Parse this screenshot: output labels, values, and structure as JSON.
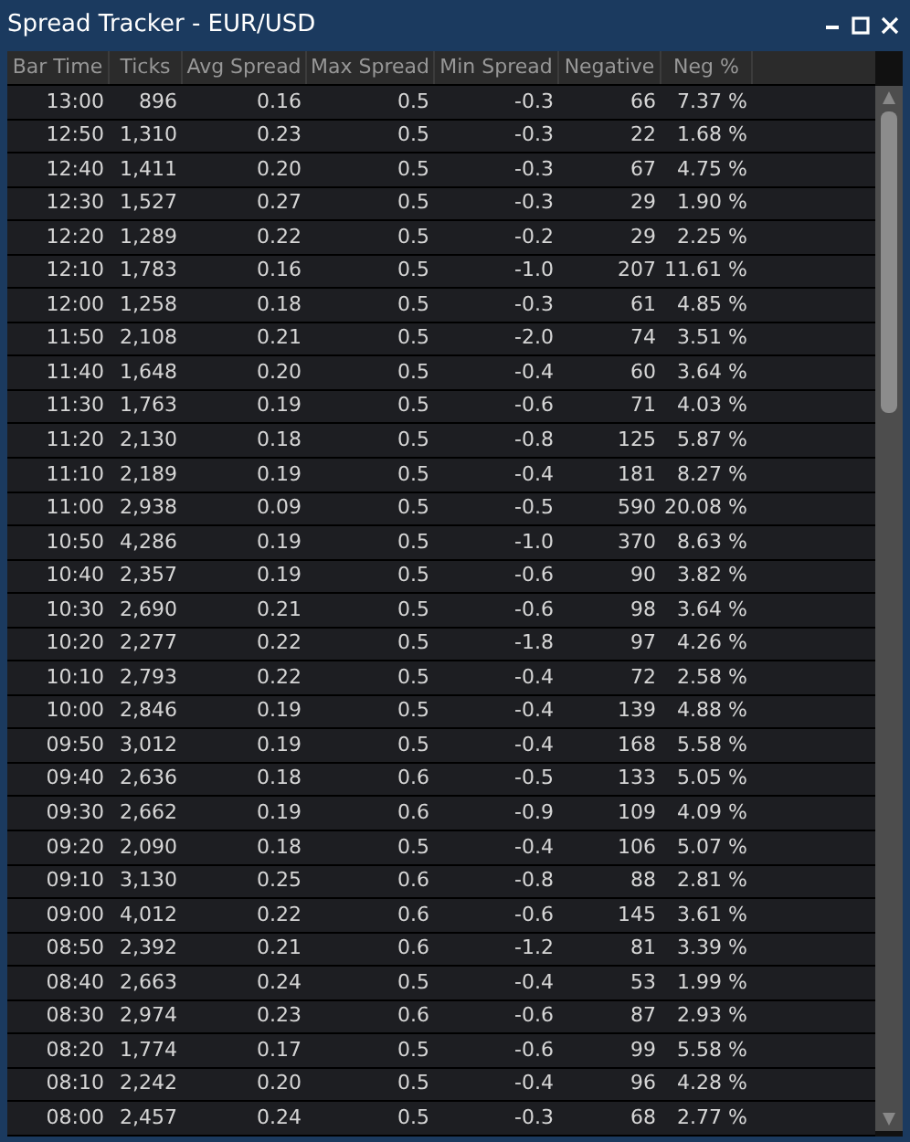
{
  "window": {
    "title": "Spread Tracker - EUR/USD"
  },
  "table": {
    "columns": [
      "Bar Time",
      "Ticks",
      "Avg Spread",
      "Max Spread",
      "Min Spread",
      "Negative",
      "Neg %"
    ],
    "rows": [
      [
        "13:00",
        "896",
        "0.16",
        "0.5",
        "-0.3",
        "66",
        "7.37 %"
      ],
      [
        "12:50",
        "1,310",
        "0.23",
        "0.5",
        "-0.3",
        "22",
        "1.68 %"
      ],
      [
        "12:40",
        "1,411",
        "0.20",
        "0.5",
        "-0.3",
        "67",
        "4.75 %"
      ],
      [
        "12:30",
        "1,527",
        "0.27",
        "0.5",
        "-0.3",
        "29",
        "1.90 %"
      ],
      [
        "12:20",
        "1,289",
        "0.22",
        "0.5",
        "-0.2",
        "29",
        "2.25 %"
      ],
      [
        "12:10",
        "1,783",
        "0.16",
        "0.5",
        "-1.0",
        "207",
        "11.61 %"
      ],
      [
        "12:00",
        "1,258",
        "0.18",
        "0.5",
        "-0.3",
        "61",
        "4.85 %"
      ],
      [
        "11:50",
        "2,108",
        "0.21",
        "0.5",
        "-2.0",
        "74",
        "3.51 %"
      ],
      [
        "11:40",
        "1,648",
        "0.20",
        "0.5",
        "-0.4",
        "60",
        "3.64 %"
      ],
      [
        "11:30",
        "1,763",
        "0.19",
        "0.5",
        "-0.6",
        "71",
        "4.03 %"
      ],
      [
        "11:20",
        "2,130",
        "0.18",
        "0.5",
        "-0.8",
        "125",
        "5.87 %"
      ],
      [
        "11:10",
        "2,189",
        "0.19",
        "0.5",
        "-0.4",
        "181",
        "8.27 %"
      ],
      [
        "11:00",
        "2,938",
        "0.09",
        "0.5",
        "-0.5",
        "590",
        "20.08 %"
      ],
      [
        "10:50",
        "4,286",
        "0.19",
        "0.5",
        "-1.0",
        "370",
        "8.63 %"
      ],
      [
        "10:40",
        "2,357",
        "0.19",
        "0.5",
        "-0.6",
        "90",
        "3.82 %"
      ],
      [
        "10:30",
        "2,690",
        "0.21",
        "0.5",
        "-0.6",
        "98",
        "3.64 %"
      ],
      [
        "10:20",
        "2,277",
        "0.22",
        "0.5",
        "-1.8",
        "97",
        "4.26 %"
      ],
      [
        "10:10",
        "2,793",
        "0.22",
        "0.5",
        "-0.4",
        "72",
        "2.58 %"
      ],
      [
        "10:00",
        "2,846",
        "0.19",
        "0.5",
        "-0.4",
        "139",
        "4.88 %"
      ],
      [
        "09:50",
        "3,012",
        "0.19",
        "0.5",
        "-0.4",
        "168",
        "5.58 %"
      ],
      [
        "09:40",
        "2,636",
        "0.18",
        "0.6",
        "-0.5",
        "133",
        "5.05 %"
      ],
      [
        "09:30",
        "2,662",
        "0.19",
        "0.6",
        "-0.9",
        "109",
        "4.09 %"
      ],
      [
        "09:20",
        "2,090",
        "0.18",
        "0.5",
        "-0.4",
        "106",
        "5.07 %"
      ],
      [
        "09:10",
        "3,130",
        "0.25",
        "0.6",
        "-0.8",
        "88",
        "2.81 %"
      ],
      [
        "09:00",
        "4,012",
        "0.22",
        "0.6",
        "-0.6",
        "145",
        "3.61 %"
      ],
      [
        "08:50",
        "2,392",
        "0.21",
        "0.6",
        "-1.2",
        "81",
        "3.39 %"
      ],
      [
        "08:40",
        "2,663",
        "0.24",
        "0.5",
        "-0.4",
        "53",
        "1.99 %"
      ],
      [
        "08:30",
        "2,974",
        "0.23",
        "0.6",
        "-0.6",
        "87",
        "2.93 %"
      ],
      [
        "08:20",
        "1,774",
        "0.17",
        "0.5",
        "-0.6",
        "99",
        "5.58 %"
      ],
      [
        "08:10",
        "2,242",
        "0.20",
        "0.5",
        "-0.4",
        "96",
        "4.28 %"
      ],
      [
        "08:00",
        "2,457",
        "0.24",
        "0.5",
        "-0.3",
        "68",
        "2.77 %"
      ]
    ]
  }
}
